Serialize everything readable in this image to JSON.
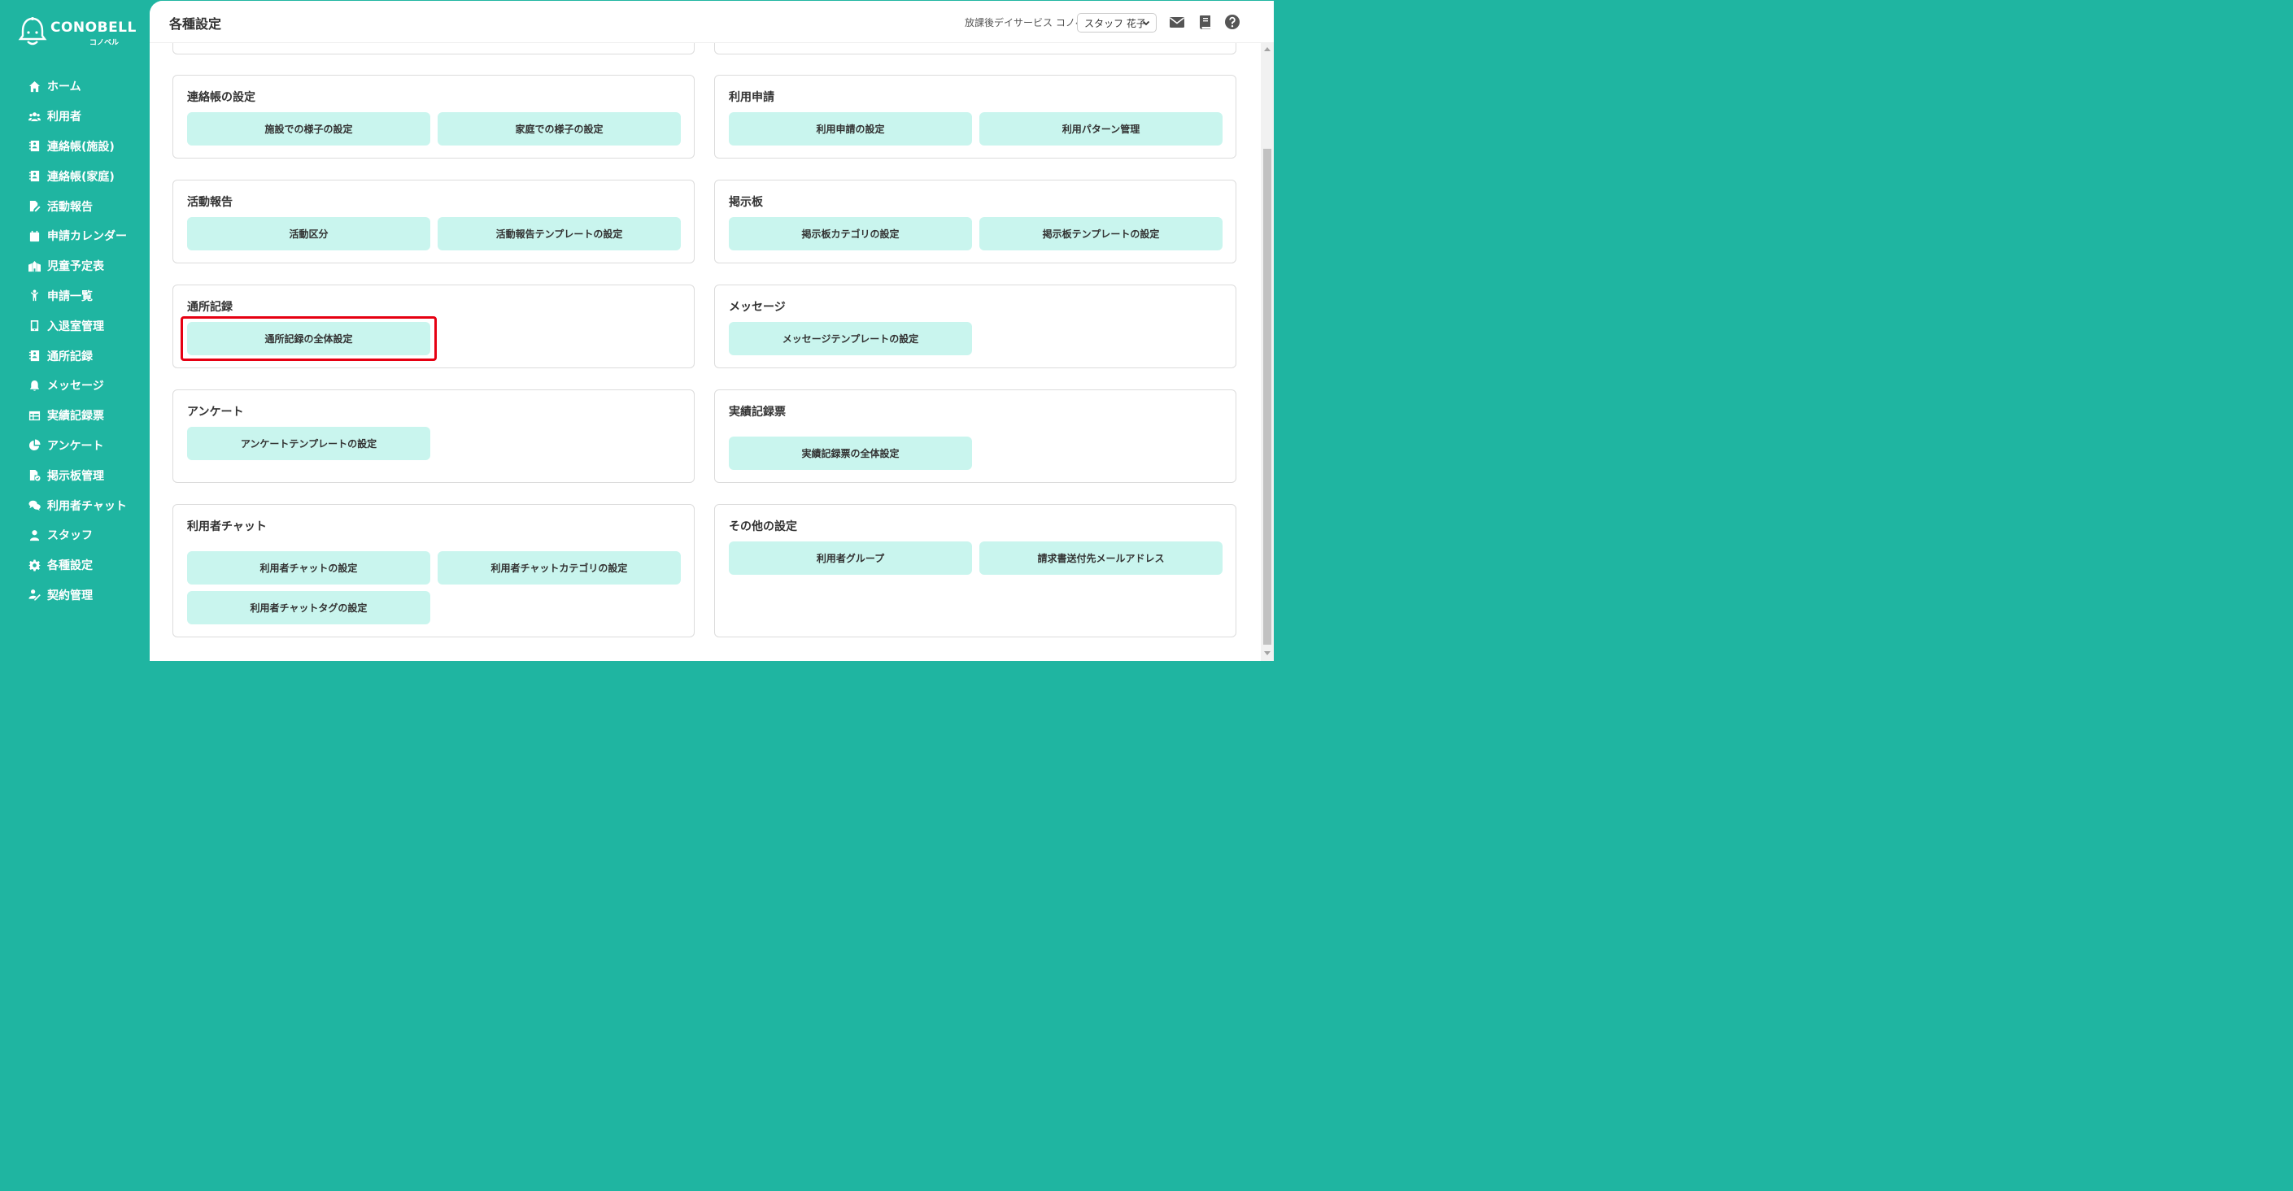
{
  "app": {
    "brand": "CONOBELL",
    "brand_sub": "コノベル"
  },
  "sidebar": {
    "items": [
      {
        "label": "ホーム",
        "icon": "home-icon"
      },
      {
        "label": "利用者",
        "icon": "users-icon"
      },
      {
        "label": "連絡帳(施設)",
        "icon": "contact-book-icon"
      },
      {
        "label": "連絡帳(家庭)",
        "icon": "contact-book-icon"
      },
      {
        "label": "活動報告",
        "icon": "report-edit-icon"
      },
      {
        "label": "申請カレンダー",
        "icon": "calendar-icon"
      },
      {
        "label": "児童予定表",
        "icon": "school-icon"
      },
      {
        "label": "申請一覧",
        "icon": "child-icon"
      },
      {
        "label": "入退室管理",
        "icon": "tablet-icon"
      },
      {
        "label": "通所記録",
        "icon": "record-icon"
      },
      {
        "label": "メッセージ",
        "icon": "bell-icon"
      },
      {
        "label": "実績記録票",
        "icon": "table-icon"
      },
      {
        "label": "アンケート",
        "icon": "pie-chart-icon"
      },
      {
        "label": "掲示板管理",
        "icon": "board-icon"
      },
      {
        "label": "利用者チャット",
        "icon": "chat-icon"
      },
      {
        "label": "スタッフ",
        "icon": "staff-icon"
      },
      {
        "label": "各種設定",
        "icon": "gear-icon"
      },
      {
        "label": "契約管理",
        "icon": "contract-icon"
      }
    ]
  },
  "header": {
    "title": "各種設定",
    "facility": "放課後デイサービス コノベル",
    "user": "スタッフ 花子"
  },
  "cards": {
    "renrakucho": {
      "title": "連絡帳の設定",
      "buttons": [
        "施設での様子の設定",
        "家庭での様子の設定"
      ]
    },
    "riyoshinsei": {
      "title": "利用申請",
      "buttons": [
        "利用申請の設定",
        "利用パターン管理"
      ]
    },
    "katsudo": {
      "title": "活動報告",
      "buttons": [
        "活動区分",
        "活動報告テンプレートの設定"
      ]
    },
    "keijiban": {
      "title": "掲示板",
      "buttons": [
        "掲示板カテゴリの設定",
        "掲示板テンプレートの設定"
      ]
    },
    "tsusho": {
      "title": "通所記録",
      "buttons": [
        "通所記録の全体設定"
      ]
    },
    "message": {
      "title": "メッセージ",
      "buttons": [
        "メッセージテンプレートの設定"
      ]
    },
    "enquete": {
      "title": "アンケート",
      "buttons": [
        "アンケートテンプレートの設定"
      ]
    },
    "jisseki": {
      "title": "実績記録票",
      "buttons": [
        "実績記録票の全体設定"
      ]
    },
    "chat": {
      "title": "利用者チャット",
      "buttons": [
        "利用者チャットの設定",
        "利用者チャットカテゴリの設定",
        "利用者チャットタグの設定"
      ]
    },
    "other": {
      "title": "その他の設定",
      "buttons": [
        "利用者グループ",
        "請求書送付先メールアドレス"
      ]
    }
  },
  "colors": {
    "brand": "#1fb5a1",
    "button_bg": "#c9f5ee",
    "highlight": "#e60012"
  }
}
